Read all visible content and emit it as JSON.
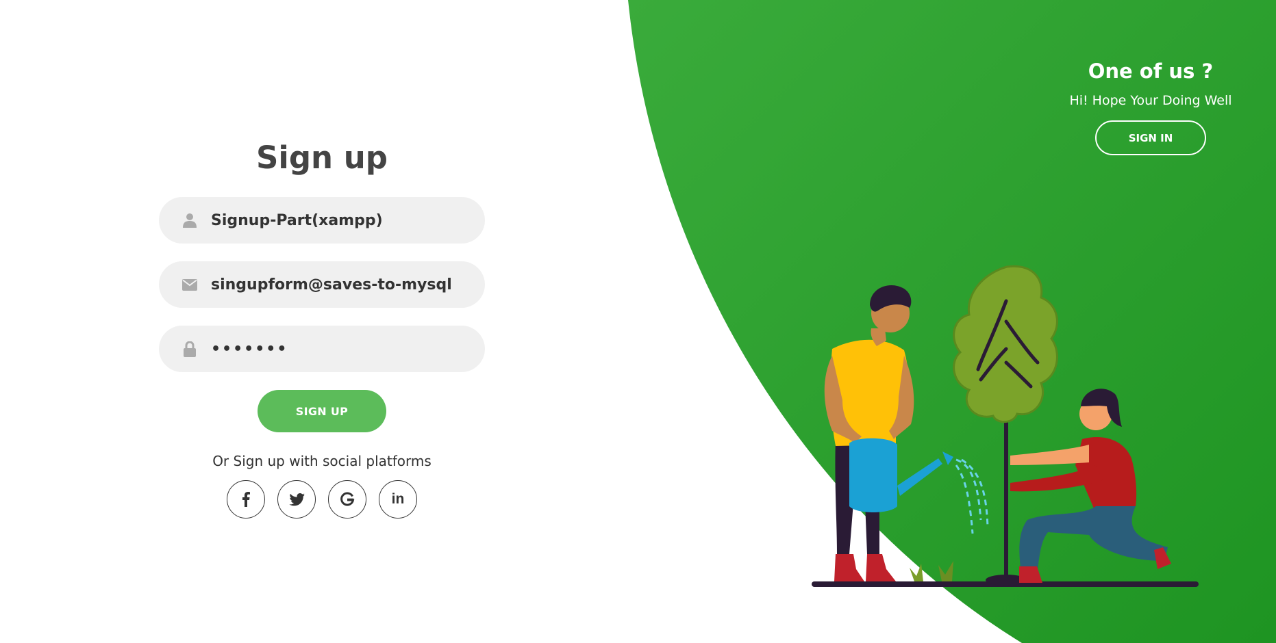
{
  "colors": {
    "accent_green": "#2a9e2f",
    "button_green": "#5cbc5a",
    "field_bg": "#f0f0f0",
    "title_text": "#444444"
  },
  "signup": {
    "title": "Sign up",
    "username": {
      "icon": "user-icon",
      "value": "Signup-Part(xampp)"
    },
    "email": {
      "icon": "envelope-icon",
      "value": "singupform@saves-to-mysql"
    },
    "password": {
      "icon": "lock-icon",
      "value": "•••••••"
    },
    "submit_label": "SIGN UP",
    "social_text": "Or Sign up with social platforms",
    "social": [
      {
        "icon": "facebook-icon"
      },
      {
        "icon": "twitter-icon"
      },
      {
        "icon": "google-icon"
      },
      {
        "icon": "linkedin-icon",
        "label": "in"
      }
    ]
  },
  "panel": {
    "title": "One of us ?",
    "subtitle": "Hi! Hope Your Doing Well",
    "signin_label": "SIGN IN"
  }
}
